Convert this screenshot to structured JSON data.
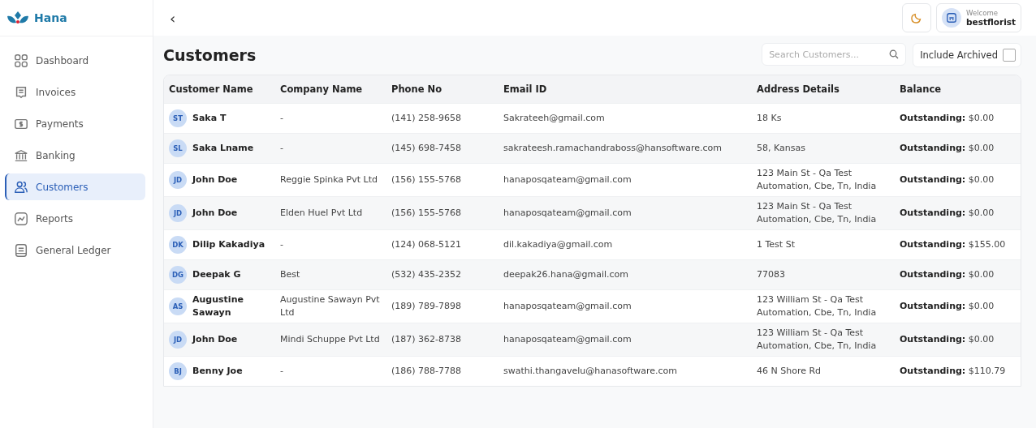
{
  "brand": {
    "name": "Hana"
  },
  "sidebar": {
    "items": [
      {
        "label": "Dashboard",
        "kind": "dashboard",
        "selected": false
      },
      {
        "label": "Invoices",
        "kind": "invoice",
        "selected": false
      },
      {
        "label": "Payments",
        "kind": "payment",
        "selected": false
      },
      {
        "label": "Banking",
        "kind": "bank",
        "selected": false
      },
      {
        "label": "Customers",
        "kind": "users",
        "selected": true
      },
      {
        "label": "Reports",
        "kind": "report",
        "selected": false
      },
      {
        "label": "General Ledger",
        "kind": "ledger",
        "selected": false
      }
    ]
  },
  "topbar": {
    "back": "‹",
    "user": {
      "greeting": "Welcome",
      "name": "bestflorist"
    }
  },
  "page": {
    "title": "Customers",
    "search": {
      "placeholder": "Search Customers..."
    },
    "include_archived": {
      "label": "Include Archived",
      "checked": false
    }
  },
  "table": {
    "columns": [
      "Customer Name",
      "Company Name",
      "Phone No",
      "Email ID",
      "Address Details",
      "Balance"
    ],
    "rows": [
      {
        "initials": "ST",
        "name": "Saka T",
        "company": "-",
        "phone": "(141) 258-9658",
        "email": "Sakrateeh@gmail.com",
        "address": "18 Ks",
        "balance": "**Outstanding:** $0.00"
      },
      {
        "initials": "SL",
        "name": "Saka Lname",
        "company": "-",
        "phone": "(145) 698-7458",
        "email": "sakrateesh.ramachandraboss@hansoftware.com",
        "address": "58, Kansas",
        "balance": "**Outstanding:** $0.00"
      },
      {
        "initials": "JD",
        "name": "John Doe",
        "company": "Reggie Spinka Pvt Ltd",
        "phone": "(156) 155-5768",
        "email": "hanaposqateam@gmail.com",
        "address": "123 Main St - Qa Test Automation, Cbe, Tn, India",
        "balance": "**Outstanding:** $0.00"
      },
      {
        "initials": "JD",
        "name": "John Doe",
        "company": "Elden Huel Pvt Ltd",
        "phone": "(156) 155-5768",
        "email": "hanaposqateam@gmail.com",
        "address": "123 Main St - Qa Test Automation, Cbe, Tn, India",
        "balance": "**Outstanding:** $0.00"
      },
      {
        "initials": "DK",
        "name": "Dilip Kakadiya",
        "company": "-",
        "phone": "(124) 068-5121",
        "email": "dil.kakadiya@gmail.com",
        "address": "1 Test St",
        "balance": "**Outstanding:** $155.00"
      },
      {
        "initials": "DG",
        "name": "Deepak G",
        "company": "Best",
        "phone": "(532) 435-2352",
        "email": "deepak26.hana@gmail.com",
        "address": "77083",
        "balance": "**Outstanding:** $0.00"
      },
      {
        "initials": "AS",
        "name": "Augustine Sawayn",
        "company": "Augustine Sawayn Pvt Ltd",
        "phone": "(189) 789-7898",
        "email": "hanaposqateam@gmail.com",
        "address": "123 William St - Qa Test Automation, Cbe, Tn, India",
        "balance": "**Outstanding:** $0.00"
      },
      {
        "initials": "JD",
        "name": "John Doe",
        "company": "Mindi Schuppe Pvt Ltd",
        "phone": "(187) 362-8738",
        "email": "hanaposqateam@gmail.com",
        "address": "123 William St - Qa Test Automation, Cbe, Tn, India",
        "balance": "**Outstanding:** $0.00"
      },
      {
        "initials": "BJ",
        "name": "Benny Joe",
        "company": "-",
        "phone": "(186) 788-7788",
        "email": "swathi.thangavelu@hanasoftware.com",
        "address": "46 N Shore Rd",
        "balance": "**Outstanding:** $110.79"
      }
    ]
  }
}
